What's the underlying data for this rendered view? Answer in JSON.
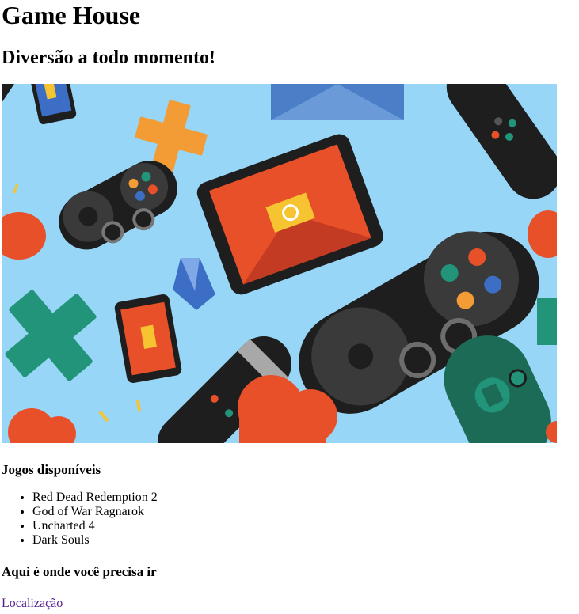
{
  "header": {
    "title": "Game House",
    "subtitle": "Diversão a todo momento!"
  },
  "banner": {
    "background": "#97d6f6"
  },
  "games": {
    "heading": "Jogos disponíveis",
    "items": [
      "Red Dead Redemption 2",
      "God of War Ragnarok",
      "Uncharted 4",
      "Dark Souls"
    ]
  },
  "location": {
    "heading": "Aqui é onde você precisa ir",
    "link_label": "Localização",
    "link_color": "#551a8b"
  }
}
